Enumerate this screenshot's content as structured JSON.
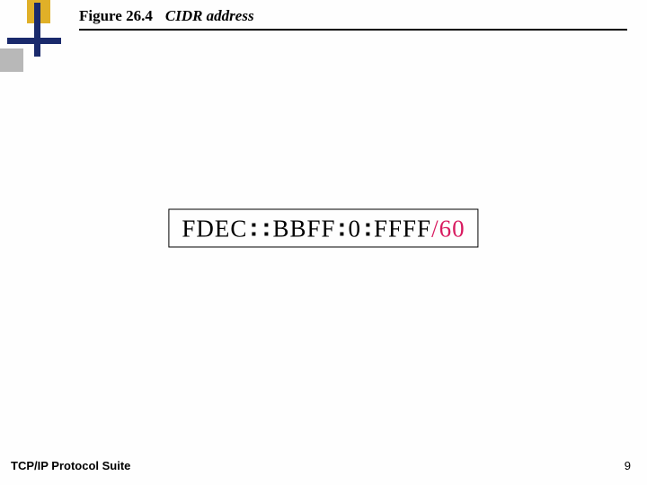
{
  "header": {
    "figure_label": "Figure 26.4",
    "figure_title": "CIDR address"
  },
  "cidr": {
    "seg1": "FDEC",
    "seg2": "BBFF",
    "seg3": "0",
    "seg4": "FFFF",
    "prefix": "/60"
  },
  "footer": {
    "suite": "TCP/IP Protocol Suite",
    "page": "9"
  }
}
